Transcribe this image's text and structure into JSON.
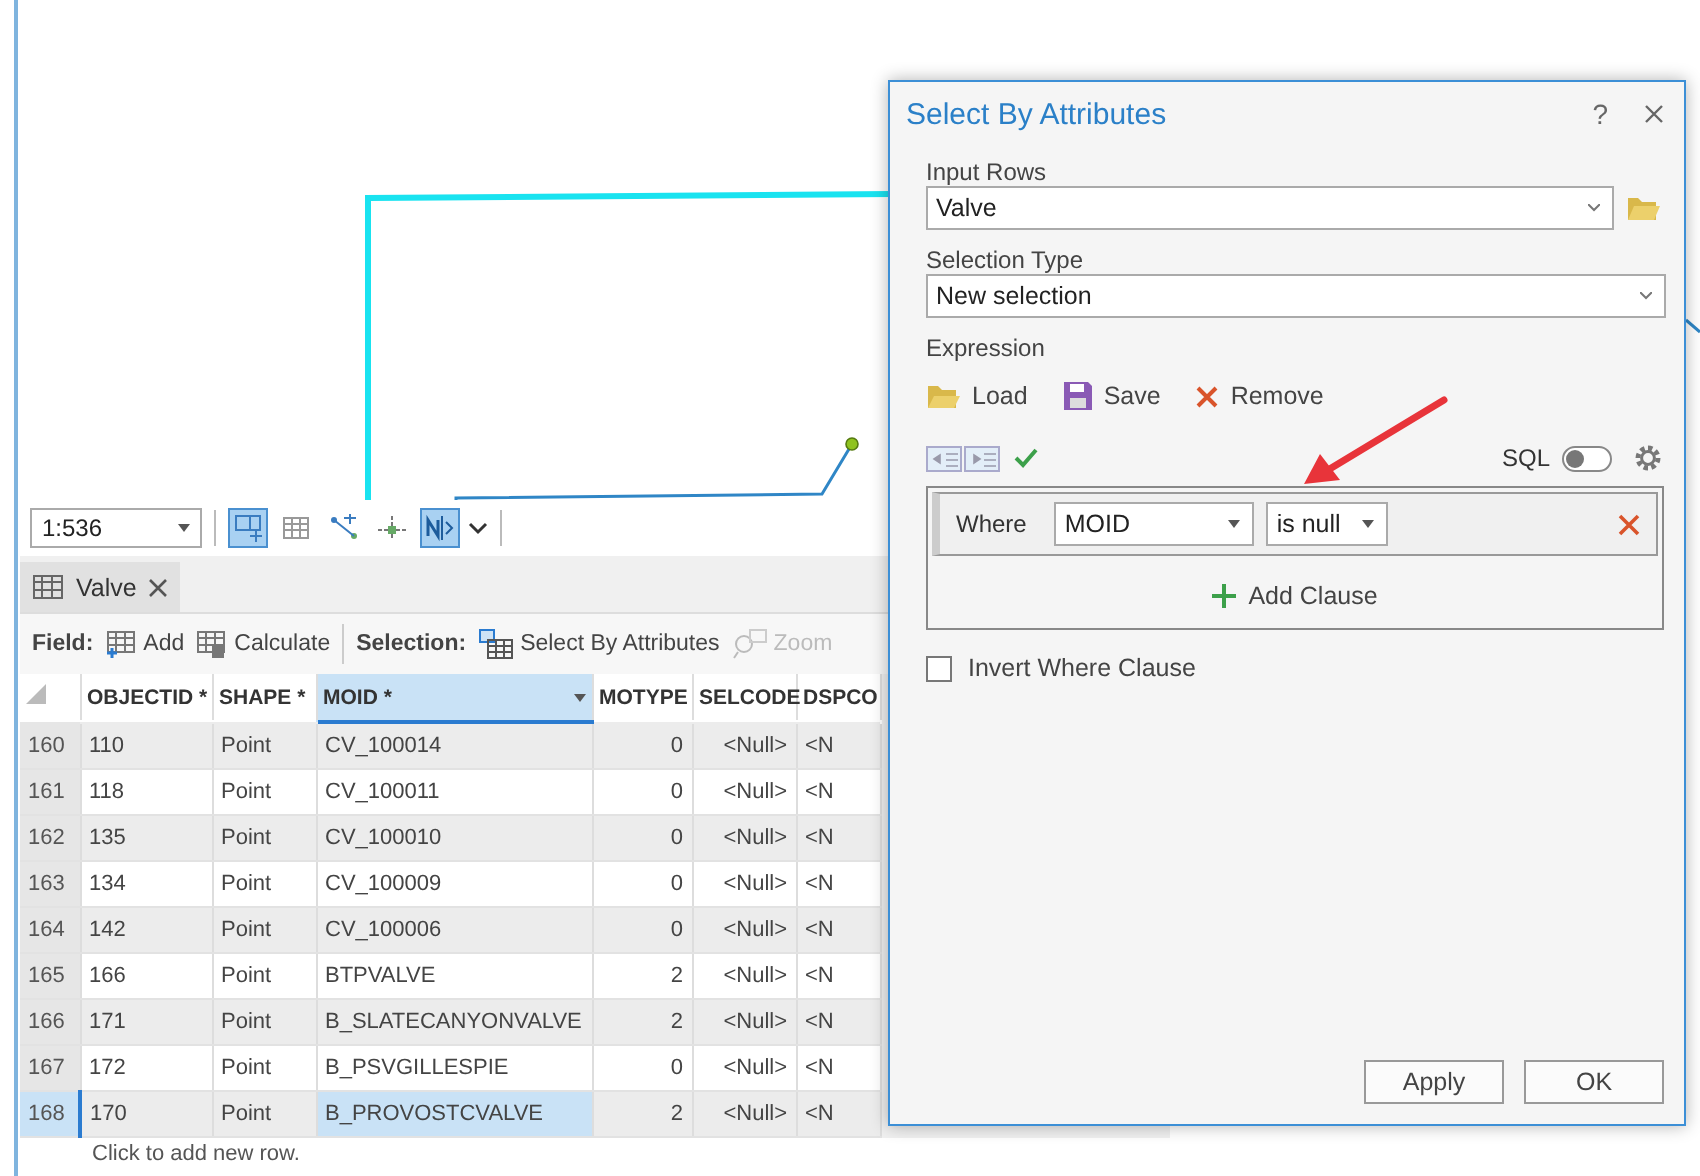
{
  "map": {
    "scale": "1:536"
  },
  "map_tools": [
    {
      "selected": true
    },
    {
      "selected": false
    },
    {
      "selected": false
    },
    {
      "selected": false
    },
    {
      "selected": true
    }
  ],
  "table_tab": {
    "title": "Valve"
  },
  "field_toolbar": {
    "field_label": "Field:",
    "field_buttons": [
      "Add",
      "Calculate"
    ],
    "selection_label": "Selection:",
    "selection_buttons": [
      {
        "label": "Select By Attributes",
        "disabled": false
      },
      {
        "label": "Zoom",
        "disabled": true
      }
    ]
  },
  "table": {
    "columns": [
      {
        "label": "OBJECTID *",
        "selected": false
      },
      {
        "label": "SHAPE *",
        "selected": false
      },
      {
        "label": "MOID *",
        "selected": true
      },
      {
        "label": "MOTYPE",
        "selected": false
      },
      {
        "label": "SELCODE",
        "selected": false
      },
      {
        "label": "DSPCO",
        "selected": false
      }
    ],
    "rows": [
      {
        "number": "160",
        "selected": false,
        "cells": [
          "110",
          "Point",
          "CV_100014",
          "0",
          "<Null>",
          "<N"
        ]
      },
      {
        "number": "161",
        "selected": false,
        "cells": [
          "118",
          "Point",
          "CV_100011",
          "0",
          "<Null>",
          "<N"
        ]
      },
      {
        "number": "162",
        "selected": false,
        "cells": [
          "135",
          "Point",
          "CV_100010",
          "0",
          "<Null>",
          "<N"
        ]
      },
      {
        "number": "163",
        "selected": false,
        "cells": [
          "134",
          "Point",
          "CV_100009",
          "0",
          "<Null>",
          "<N"
        ]
      },
      {
        "number": "164",
        "selected": false,
        "cells": [
          "142",
          "Point",
          "CV_100006",
          "0",
          "<Null>",
          "<N"
        ]
      },
      {
        "number": "165",
        "selected": false,
        "cells": [
          "166",
          "Point",
          "BTPVALVE",
          "2",
          "<Null>",
          "<N"
        ]
      },
      {
        "number": "166",
        "selected": false,
        "cells": [
          "171",
          "Point",
          "B_SLATECANYONVALVE",
          "2",
          "<Null>",
          "<N"
        ]
      },
      {
        "number": "167",
        "selected": false,
        "cells": [
          "172",
          "Point",
          "B_PSVGILLESPIE",
          "0",
          "<Null>",
          "<N"
        ]
      },
      {
        "number": "168",
        "selected": true,
        "cells": [
          "170",
          "Point",
          "B_PROVOSTCVALVE",
          "2",
          "<Null>",
          "<N"
        ]
      }
    ],
    "new_row_hint": "Click to add new row."
  },
  "dialog": {
    "title": "Select By Attributes",
    "help": "?",
    "input_rows": {
      "label": "Input Rows",
      "value": "Valve"
    },
    "selection_type": {
      "label": "Selection Type",
      "value": "New selection"
    },
    "expression_label": "Expression",
    "expression_actions": [
      "Load",
      "Save",
      "Remove"
    ],
    "sql": {
      "label": "SQL",
      "on": false
    },
    "clause": {
      "prefix": "Where",
      "field": "MOID",
      "operator": "is null"
    },
    "add_clause": "Add Clause",
    "invert": {
      "label": "Invert Where Clause",
      "checked": false
    },
    "buttons": [
      "Apply",
      "OK"
    ]
  }
}
